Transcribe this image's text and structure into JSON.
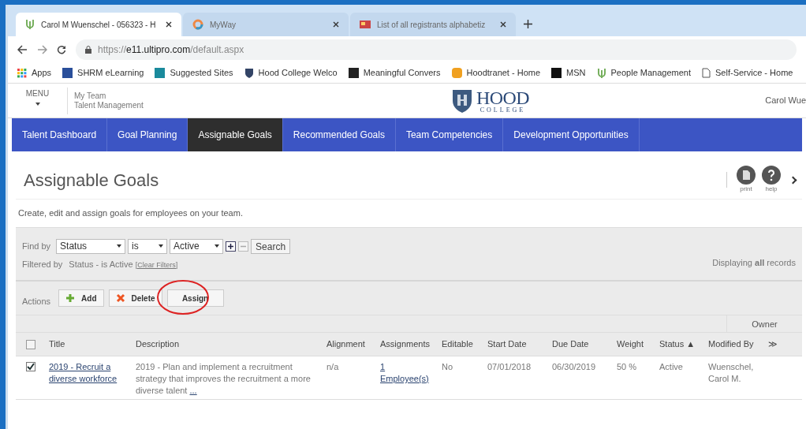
{
  "browser": {
    "tabs": [
      {
        "title": "Carol M Wuenschel - 056323 - H",
        "selected": true
      },
      {
        "title": "MyWay",
        "selected": false
      },
      {
        "title": "List of all registrants alphabetiz",
        "selected": false
      }
    ],
    "url_host": "https://e11.ultipro.com",
    "url_path": "/default.aspx",
    "bookmarks": [
      "Apps",
      "SHRM eLearning",
      "Suggested Sites",
      "Hood College Welco",
      "Meaningful Convers",
      "Hoodtranet - Home",
      "MSN",
      "People Management",
      "Self-Service - Home"
    ]
  },
  "header": {
    "menu": "MENU",
    "breadcrumb_top": "My Team",
    "breadcrumb_bottom": "Talent Management",
    "logo_main": "HOOD",
    "logo_sub": "COLLEGE",
    "user": "Carol Wue"
  },
  "nav": [
    {
      "label": "Talent Dashboard",
      "selected": false
    },
    {
      "label": "Goal Planning",
      "selected": false
    },
    {
      "label": "Assignable Goals",
      "selected": true
    },
    {
      "label": "Recommended Goals",
      "selected": false
    },
    {
      "label": "Team Competencies",
      "selected": false
    },
    {
      "label": "Development Opportunities",
      "selected": false
    }
  ],
  "page": {
    "title": "Assignable Goals",
    "tools": [
      {
        "label": "print",
        "kind": "print"
      },
      {
        "label": "help",
        "kind": "help"
      }
    ],
    "description": "Create, edit and assign goals for employees on your team."
  },
  "filter": {
    "label": "Find by",
    "field": "Status",
    "operator": "is",
    "value": "Active",
    "search": "Search",
    "filtered_label": "Filtered by",
    "filtered_text": "Status - is Active",
    "clear": "[Clear Filters]",
    "displaying": "Displaying **all** records"
  },
  "actions": {
    "label": "Actions",
    "buttons": [
      {
        "label": "Add",
        "kind": "add",
        "circled": false
      },
      {
        "label": "Delete",
        "kind": "delete",
        "circled": false
      },
      {
        "label": "Assign",
        "kind": "assign",
        "circled": true
      }
    ]
  },
  "table": {
    "group_header": "Owner",
    "all_checked": false,
    "columns": [
      "Title",
      "Description",
      "Alignment",
      "Assignments",
      "Editable",
      "Start Date",
      "Due Date",
      "Weight",
      "Status ▲",
      "Modified By",
      "≫"
    ],
    "rows": [
      {
        "checked": true,
        "title": "2019 - Recruit a diverse workforce",
        "description": "2019 - Plan and implement a recruitment strategy that improves the recruitment a more diverse talent",
        "more": "...",
        "alignment": "n/a",
        "assignments": "1 Employee(s)",
        "editable": "No",
        "start_date": "07/01/2018",
        "due_date": "06/30/2019",
        "weight": "50 %",
        "status": "Active",
        "modified_by": "Wuenschel, Carol M."
      }
    ]
  }
}
